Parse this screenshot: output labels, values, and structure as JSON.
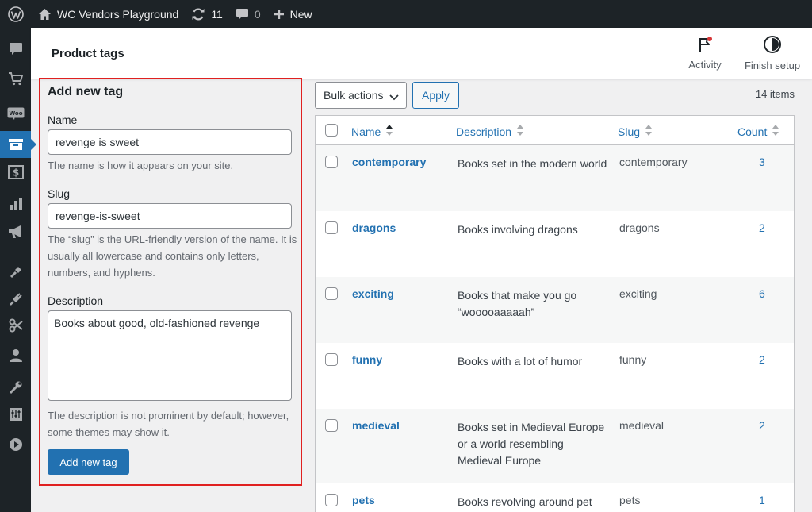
{
  "adminbar": {
    "site_name": "WC Vendors Playground",
    "updates_count": "11",
    "comments_count": "0",
    "new_label": "New"
  },
  "sidemenu": {
    "icons": [
      "comments-icon",
      "cart-icon",
      "woo-icon",
      "products-icon",
      "payments-icon",
      "analytics-icon",
      "marketing-icon",
      "appearance-icon",
      "plugins-icon",
      "vendors-icon",
      "users-icon",
      "tools-icon",
      "settings-icon",
      "media-player-icon"
    ],
    "active": "products-icon"
  },
  "header": {
    "title": "Product tags",
    "activity_label": "Activity",
    "finish_setup_label": "Finish setup"
  },
  "form": {
    "heading": "Add new tag",
    "name_label": "Name",
    "name_value": "revenge is sweet",
    "name_help": "The name is how it appears on your site.",
    "slug_label": "Slug",
    "slug_value": "revenge-is-sweet",
    "slug_help": "The “slug” is the URL-friendly version of the name. It is usually all lowercase and contains only letters, numbers, and hyphens.",
    "description_label": "Description",
    "description_value": "Books about good, old-fashioned revenge",
    "description_help": "The description is not prominent by default; however, some themes may show it.",
    "submit_label": "Add new tag"
  },
  "table": {
    "bulk_actions_label": "Bulk actions",
    "apply_label": "Apply",
    "items_count": "14 items",
    "columns": {
      "name": "Name",
      "description": "Description",
      "slug": "Slug",
      "count": "Count"
    },
    "rows": [
      {
        "name": "contemporary",
        "description": "Books set in the modern world",
        "slug": "contemporary",
        "count": "3"
      },
      {
        "name": "dragons",
        "description": "Books involving dragons",
        "slug": "dragons",
        "count": "2"
      },
      {
        "name": "exciting",
        "description": "Books that make you go “wooooaaaaah”",
        "slug": "exciting",
        "count": "6"
      },
      {
        "name": "funny",
        "description": "Books with a lot of humor",
        "slug": "funny",
        "count": "2"
      },
      {
        "name": "medieval",
        "description": "Books set in Medieval Europe or a world resembling Medieval Europe",
        "slug": "medieval",
        "count": "2"
      },
      {
        "name": "pets",
        "description": "Books revolving around pet",
        "slug": "pets",
        "count": "1"
      }
    ]
  },
  "colors": {
    "admin_dark": "#1d2327",
    "accent": "#2271b1",
    "highlight_border": "#e02020",
    "notification_dot": "#d63638"
  }
}
